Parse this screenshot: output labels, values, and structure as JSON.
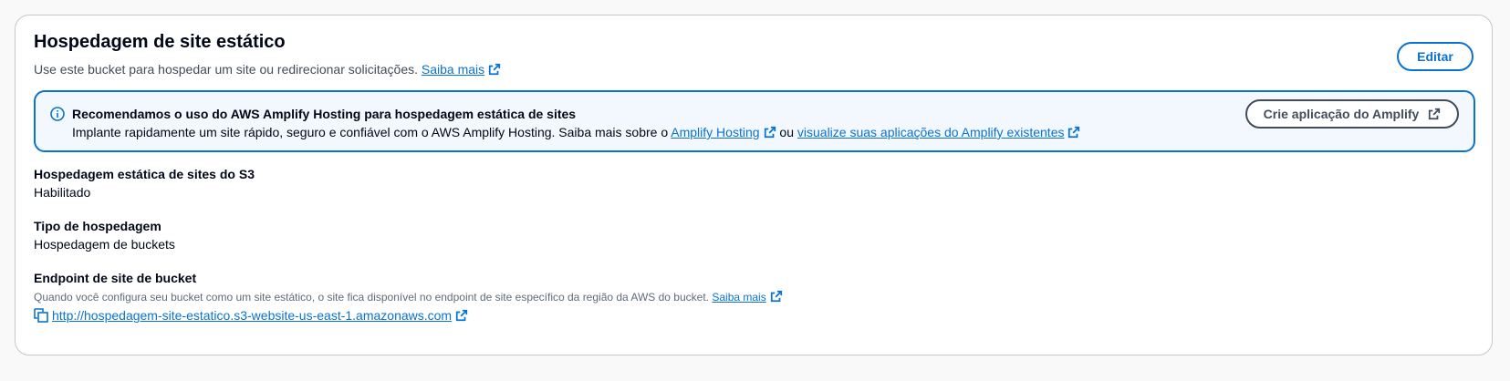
{
  "panel": {
    "title": "Hospedagem de site estático",
    "description": "Use este bucket para hospedar um site ou redirecionar solicitações.",
    "learn_more": "Saiba mais",
    "edit_label": "Editar"
  },
  "alert": {
    "title": "Recomendamos o uso do AWS Amplify Hosting para hospedagem estática de sites",
    "text_prefix": "Implante rapidamente um site rápido, seguro e confiável com o AWS Amplify Hosting. Saiba mais sobre o",
    "link_amplify": "Amplify Hosting",
    "text_or": "ou",
    "link_apps": "visualize suas aplicações do Amplify existentes",
    "button_label": "Crie aplicação do Amplify"
  },
  "fields": {
    "static_hosting": {
      "label": "Hospedagem estática de sites do S3",
      "value": "Habilitado"
    },
    "hosting_type": {
      "label": "Tipo de hospedagem",
      "value": "Hospedagem de buckets"
    },
    "endpoint": {
      "label": "Endpoint de site de bucket",
      "description": "Quando você configura seu bucket como um site estático, o site fica disponível no endpoint de site específico da região da AWS do bucket.",
      "learn_more": "Saiba mais",
      "url": "http://hospedagem-site-estatico.s3-website-us-east-1.amazonaws.com"
    }
  },
  "colors": {
    "link": "#0972d3",
    "alert_bg": "#f2f8fd",
    "alert_border": "#0972d3",
    "text": "#000716",
    "secondary_text": "#5f6b7a"
  },
  "icons": {
    "external": "external-link-icon",
    "info": "info-icon",
    "copy": "copy-icon"
  }
}
